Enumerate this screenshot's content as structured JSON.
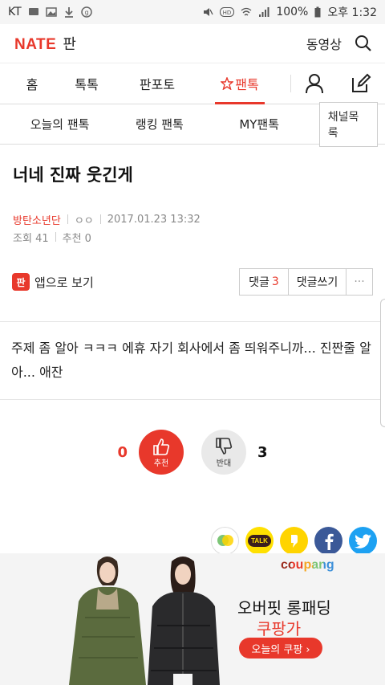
{
  "status_bar": {
    "carrier": "KT",
    "battery": "100%",
    "time": "오후 1:32"
  },
  "header": {
    "logo_brand": "NATE",
    "logo_service": "판",
    "video_link": "동영상"
  },
  "nav": {
    "tabs": [
      {
        "label": "홈"
      },
      {
        "label": "톡톡"
      },
      {
        "label": "판포토"
      },
      {
        "label": "팬톡",
        "active": true
      }
    ]
  },
  "subnav": {
    "items": [
      {
        "label": "오늘의 팬톡"
      },
      {
        "label": "랭킹 팬톡"
      },
      {
        "label": "MY팬톡"
      }
    ],
    "channel_list_button": "채널목록"
  },
  "article": {
    "title": "너네 진짜 웃긴게",
    "channel": "방탄소년단",
    "author": "ㅇㅇ",
    "date": "2017.01.23 13:32",
    "views_label": "조회",
    "views": "41",
    "recommend_label": "추천",
    "recommend": "0",
    "app_view_badge": "판",
    "app_view": "앱으로 보기",
    "comments_label": "댓글",
    "comments_count": "3",
    "write_comment": "댓글쓰기",
    "more": "···",
    "body": "주제 좀 알아 ㅋㅋㅋ 에휴 자기 회사에서 좀 띄워주니까... 진짠줄 알아... 애잔"
  },
  "vote": {
    "up_count": "0",
    "up_label": "추천",
    "down_label": "반대",
    "down_count": "3"
  },
  "share": {
    "talk_label": "TALK"
  },
  "ad": {
    "brand": "coupang",
    "line1": "오버핏 롱패딩",
    "line2": "쿠팡가",
    "button": "오늘의 쿠팡 ›"
  },
  "colors": {
    "accent": "#e8382b",
    "facebook": "#3b5998",
    "twitter": "#1da1f2",
    "kakao": "#ffe000"
  }
}
